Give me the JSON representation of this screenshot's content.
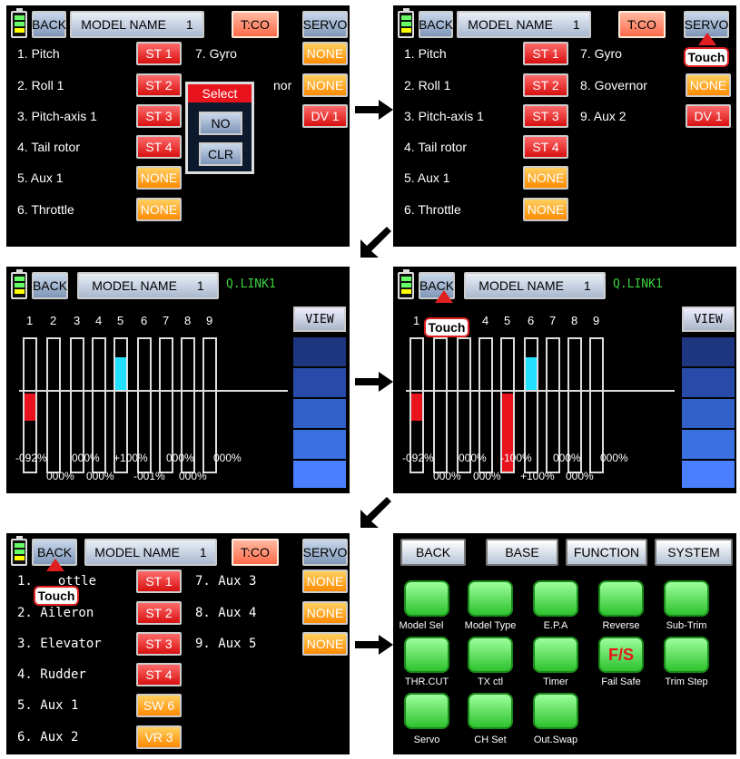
{
  "header": {
    "back": "BACK",
    "model_name": "MODEL NAME",
    "model_num": "1",
    "tco": "T:CO",
    "servo": "SERVO"
  },
  "screen1": {
    "rows": [
      {
        "label": "1. Pitch",
        "chip": "ST 1"
      },
      {
        "label": "2. Roll 1",
        "chip": "ST 2"
      },
      {
        "label": "3. Pitch-axis 1",
        "chip": "ST 3"
      },
      {
        "label": "4. Tail rotor",
        "chip": "ST 4"
      },
      {
        "label": "5. Aux 1",
        "chip": "NONE"
      },
      {
        "label": "6. Throttle",
        "chip": "NONE"
      }
    ],
    "right_rows": [
      {
        "label": "7. Gyro",
        "chip": "NONE"
      },
      {
        "label": "nor",
        "chip": "NONE"
      },
      {
        "label": "",
        "chip": "DV 1"
      }
    ],
    "popup": {
      "title": "Select",
      "no": "NO",
      "clr": "CLR"
    }
  },
  "screen2": {
    "rows": [
      {
        "label": "1. Pitch",
        "chip": "ST 1"
      },
      {
        "label": "2. Roll 1",
        "chip": "ST 2"
      },
      {
        "label": "3. Pitch-axis 1",
        "chip": "ST 3"
      },
      {
        "label": "4. Tail rotor",
        "chip": "ST 4"
      },
      {
        "label": "5. Aux 1",
        "chip": "NONE"
      },
      {
        "label": "6. Throttle",
        "chip": "NONE"
      }
    ],
    "right_rows": [
      {
        "label": "7. Gyro",
        "chip": ""
      },
      {
        "label": "8. Governor",
        "chip": "NONE"
      },
      {
        "label": "9. Aux 2",
        "chip": "DV 1"
      }
    ],
    "touch": "Touch"
  },
  "screen3": {
    "title": "Q.LINK1",
    "view": "VIEW",
    "channels": [
      "1",
      "2",
      "3",
      "4",
      "5",
      "6",
      "7",
      "8",
      "9"
    ],
    "pct_top": [
      "-092%",
      "000%",
      "+100%",
      "000%",
      "000%"
    ],
    "pct_bottom": [
      "000%",
      "000%",
      "-001%",
      "000%"
    ]
  },
  "screen4": {
    "title": "Q.LINK1",
    "view": "VIEW",
    "channels": [
      "1",
      "4",
      "5",
      "6",
      "7",
      "8",
      "9"
    ],
    "touch": "Touch",
    "pct_top": [
      "-092%",
      "000%",
      "-100%",
      "000%",
      "000%"
    ],
    "pct_bottom": [
      "000%",
      "000%",
      "+100%",
      "000%"
    ]
  },
  "screen5": {
    "rows": [
      {
        "label": "ottle",
        "chip": "ST 1"
      },
      {
        "label": "2. Aileron",
        "chip": "ST 2"
      },
      {
        "label": "3. Elevator",
        "chip": "ST 3"
      },
      {
        "label": "4. Rudder",
        "chip": "ST 4"
      },
      {
        "label": "5. Aux 1",
        "chip": "SW 6"
      },
      {
        "label": "6. Aux 2",
        "chip": "VR 3"
      }
    ],
    "right_rows": [
      {
        "label": "7. Aux 3",
        "chip": "NONE"
      },
      {
        "label": "8. Aux 4",
        "chip": "NONE"
      },
      {
        "label": "9. Aux 5",
        "chip": "NONE"
      }
    ],
    "touch": "Touch"
  },
  "screen6": {
    "tabs": [
      "BACK",
      "BASE",
      "FUNCTION",
      "SYSTEM"
    ],
    "icons": [
      "Model Sel",
      "Model Type",
      "E.P.A",
      "Reverse",
      "Sub-Trim",
      "THR.CUT",
      "TX ctl",
      "Timer",
      "Fail Safe",
      "Trim Step",
      "Servo",
      "CH Set",
      "Out.Swap"
    ],
    "icon_fs": "F/S"
  }
}
